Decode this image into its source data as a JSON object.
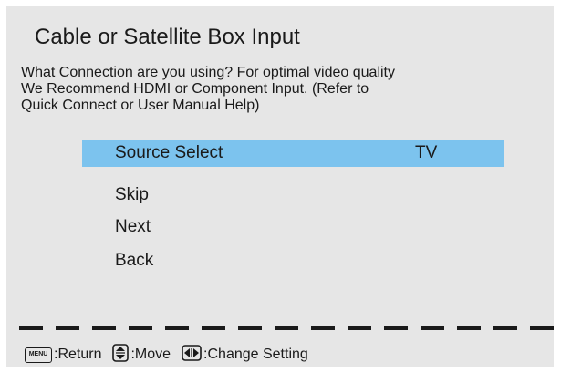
{
  "dialog": {
    "title": "Cable or Satellite Box Input",
    "description_lines": [
      "What Connection are you using? For optimal video quality",
      "We Recommend HDMI or Component Input. (Refer to",
      "Quick Connect or User Manual Help)"
    ]
  },
  "menu": {
    "source_select": {
      "label": "Source Select",
      "value": "TV",
      "selected": true
    },
    "items": [
      {
        "label": "Skip"
      },
      {
        "label": "Next"
      },
      {
        "label": "Back"
      }
    ]
  },
  "footer": {
    "menu_key": "MENU",
    "menu_action": ":Return",
    "move_icon": "up-down-arrow-icon",
    "move_action": ":Move",
    "change_icon": "left-right-arrow-icon",
    "change_action": ":Change Setting"
  },
  "colors": {
    "background": "#e6e6e6",
    "highlight": "#7cc3ee",
    "text": "#1a1a1a"
  }
}
